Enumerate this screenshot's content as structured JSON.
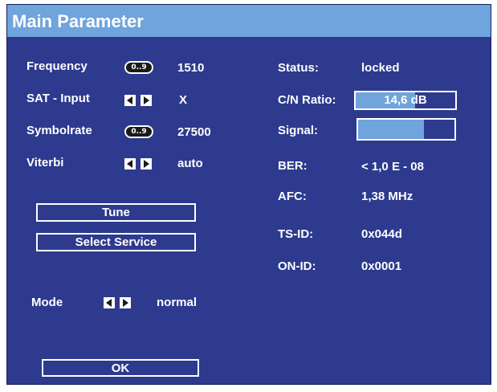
{
  "title": "Main Parameter",
  "left": {
    "frequency": {
      "label": "Frequency",
      "key": "0..9",
      "value": "1510"
    },
    "sat_input": {
      "label": "SAT - Input",
      "value": "X"
    },
    "symbolrate": {
      "label": "Symbolrate",
      "key": "0..9",
      "value": "27500"
    },
    "viterbi": {
      "label": "Viterbi",
      "value": "auto"
    },
    "mode": {
      "label": "Mode",
      "value": "normal"
    }
  },
  "buttons": {
    "tune": "Tune",
    "select_service": "Select Service",
    "ok": "OK"
  },
  "right": {
    "status": {
      "label": "Status:",
      "value": "locked"
    },
    "cn_ratio": {
      "label": "C/N Ratio:",
      "value": "14,6 dB",
      "level": 0.6
    },
    "signal": {
      "label": "Signal:",
      "level": 0.68
    },
    "ber": {
      "label": "BER:",
      "value": "< 1,0 E - 08"
    },
    "afc": {
      "label": "AFC:",
      "value": "1,38 MHz"
    },
    "ts_id": {
      "label": "TS-ID:",
      "value": "0x044d"
    },
    "on_id": {
      "label": "ON-ID:",
      "value": "0x0001"
    }
  },
  "colors": {
    "background": "#2d3a8e",
    "titlebar": "#6fa4dc",
    "bar_fill": "#6fa4dc",
    "text": "#ffffff"
  },
  "icons": {
    "numeric_key": "numeric-key-icon",
    "arrow_left": "arrow-left-icon",
    "arrow_right": "arrow-right-icon"
  }
}
